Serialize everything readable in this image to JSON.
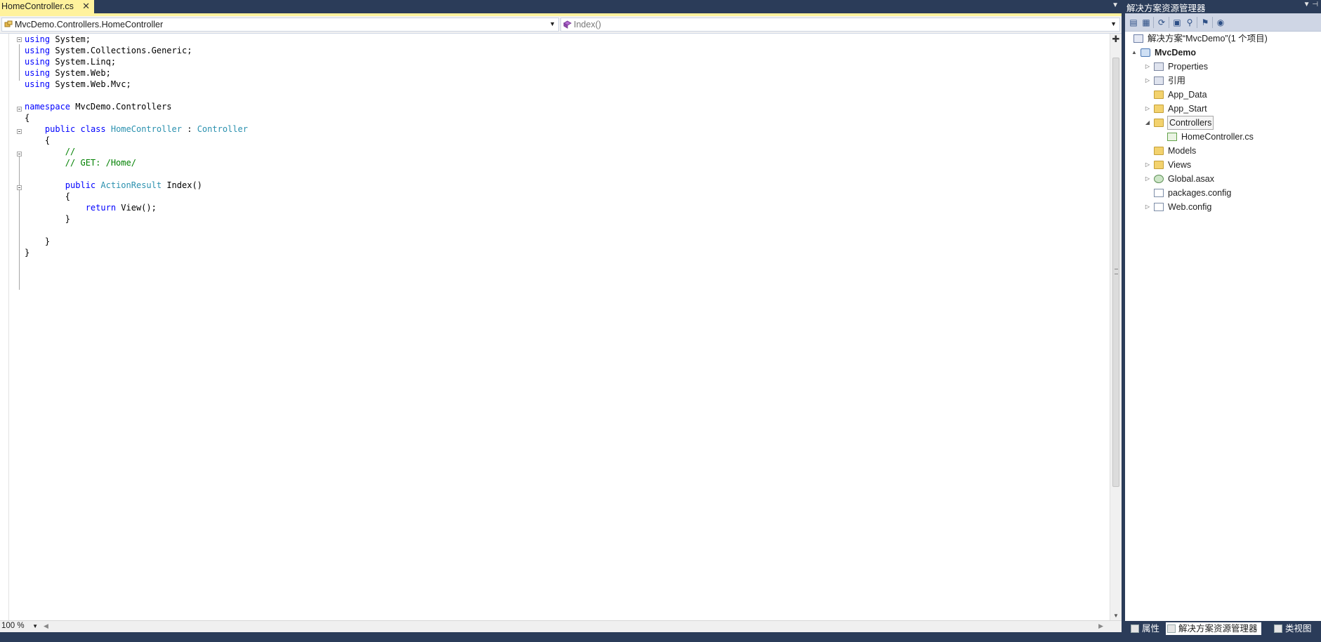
{
  "editor": {
    "tab": {
      "title": "HomeController.cs",
      "close_glyph": "✕"
    },
    "nav": {
      "type_value": "MvcDemo.Controllers.HomeController",
      "member_value": "Index()"
    },
    "code_lines": [
      [
        {
          "t": "using",
          "c": "kw"
        },
        {
          "t": " System;"
        }
      ],
      [
        {
          "t": "using",
          "c": "kw"
        },
        {
          "t": " System.Collections.Generic;"
        }
      ],
      [
        {
          "t": "using",
          "c": "kw"
        },
        {
          "t": " System.Linq;"
        }
      ],
      [
        {
          "t": "using",
          "c": "kw"
        },
        {
          "t": " System.Web;"
        }
      ],
      [
        {
          "t": "using",
          "c": "kw"
        },
        {
          "t": " System.Web.Mvc;"
        }
      ],
      [],
      [
        {
          "t": "namespace",
          "c": "kw"
        },
        {
          "t": " MvcDemo.Controllers"
        }
      ],
      [
        {
          "t": "{"
        }
      ],
      [
        {
          "t": "    "
        },
        {
          "t": "public",
          "c": "kw"
        },
        {
          "t": " "
        },
        {
          "t": "class",
          "c": "kw"
        },
        {
          "t": " "
        },
        {
          "t": "HomeController",
          "c": "ty"
        },
        {
          "t": " : "
        },
        {
          "t": "Controller",
          "c": "ty"
        }
      ],
      [
        {
          "t": "    {"
        }
      ],
      [
        {
          "t": "        "
        },
        {
          "t": "//",
          "c": "cm"
        }
      ],
      [
        {
          "t": "        "
        },
        {
          "t": "// GET: /Home/",
          "c": "cm"
        }
      ],
      [],
      [
        {
          "t": "        "
        },
        {
          "t": "public",
          "c": "kw"
        },
        {
          "t": " "
        },
        {
          "t": "ActionResult",
          "c": "ty"
        },
        {
          "t": " Index()"
        }
      ],
      [
        {
          "t": "        {"
        }
      ],
      [
        {
          "t": "            "
        },
        {
          "t": "return",
          "c": "kw"
        },
        {
          "t": " View();"
        }
      ],
      [
        {
          "t": "        }"
        }
      ],
      [],
      [
        {
          "t": "    }"
        }
      ],
      [
        {
          "t": "}"
        }
      ]
    ],
    "zoom": "100 %"
  },
  "solution_explorer": {
    "title": "解决方案资源管理器",
    "tree": [
      {
        "label": "解决方案“MvcDemo”(1 个项目)",
        "icon": "solution-icon",
        "level": 0,
        "expander": "",
        "bold": false
      },
      {
        "label": "MvcDemo",
        "icon": "project-icon",
        "level": 0,
        "expander": "▲",
        "bold": true
      },
      {
        "label": "Properties",
        "icon": "properties-folder-icon",
        "level": 1,
        "expander": "▷",
        "bold": false
      },
      {
        "label": "引用",
        "icon": "references-icon",
        "level": 1,
        "expander": "▷",
        "bold": false
      },
      {
        "label": "App_Data",
        "icon": "folder-icon",
        "level": 1,
        "expander": "",
        "bold": false
      },
      {
        "label": "App_Start",
        "icon": "folder-icon",
        "level": 1,
        "expander": "▷",
        "bold": false
      },
      {
        "label": "Controllers",
        "icon": "folder-open-icon",
        "level": 1,
        "expander": "◢",
        "bold": false,
        "selected": true
      },
      {
        "label": "HomeController.cs",
        "icon": "csharp-file-icon",
        "level": 2,
        "expander": "",
        "bold": false
      },
      {
        "label": "Models",
        "icon": "folder-icon",
        "level": 1,
        "expander": "",
        "bold": false
      },
      {
        "label": "Views",
        "icon": "folder-icon",
        "level": 1,
        "expander": "▷",
        "bold": false
      },
      {
        "label": "Global.asax",
        "icon": "global-asax-icon",
        "level": 1,
        "expander": "▷",
        "bold": false
      },
      {
        "label": "packages.config",
        "icon": "config-file-icon",
        "level": 1,
        "expander": "",
        "bold": false
      },
      {
        "label": "Web.config",
        "icon": "config-file-icon",
        "level": 1,
        "expander": "▷",
        "bold": false
      }
    ],
    "bottom_tabs": {
      "properties": "属性",
      "solution": "解决方案资源管理器",
      "class_view": "类视图"
    }
  }
}
